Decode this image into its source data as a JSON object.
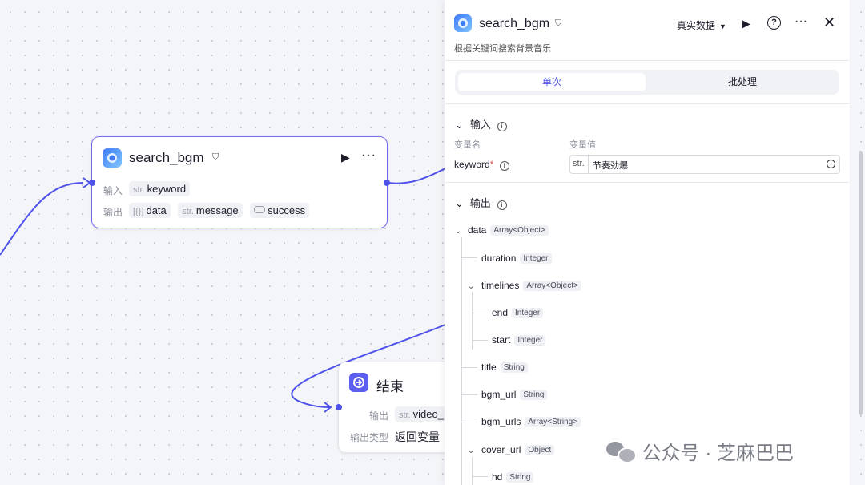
{
  "search_node": {
    "title": "search_bgm",
    "input_label": "输入",
    "output_label": "输出",
    "inputs": [
      {
        "type": "str.",
        "name": "keyword"
      }
    ],
    "outputs": [
      {
        "type": "[{}]",
        "name": "data"
      },
      {
        "type": "str.",
        "name": "message"
      },
      {
        "type": "toggle",
        "name": "success"
      }
    ]
  },
  "end_node": {
    "title": "结束",
    "output_label": "输出",
    "output_type": "str.",
    "output_name": "video_",
    "output_kind_label": "输出类型",
    "output_kind_value": "返回变量"
  },
  "panel": {
    "title": "search_bgm",
    "description": "根据关键词搜索背景音乐",
    "data_mode": "真实数据",
    "tabs": [
      "单次",
      "批处理"
    ],
    "input_section": "输入",
    "col_name": "变量名",
    "col_value": "变量值",
    "var_name": "keyword",
    "var_type": "str.",
    "var_value": "节奏劲爆",
    "output_section": "输出",
    "outputs": [
      {
        "name": "data",
        "type": "Array<Object>"
      },
      {
        "name": "duration",
        "type": "Integer"
      },
      {
        "name": "timelines",
        "type": "Array<Object>"
      },
      {
        "name": "end",
        "type": "Integer"
      },
      {
        "name": "start",
        "type": "Integer"
      },
      {
        "name": "title",
        "type": "String"
      },
      {
        "name": "bgm_url",
        "type": "String"
      },
      {
        "name": "bgm_urls",
        "type": "Array<String>"
      },
      {
        "name": "cover_url",
        "type": "Object"
      },
      {
        "name": "hd",
        "type": "String"
      }
    ]
  },
  "watermark": "公众号 · 芝麻巴巴",
  "colors": {
    "accent": "#4e52ea",
    "selected_border": "#6f6bf5",
    "end_icon": "#5b5ef0"
  }
}
